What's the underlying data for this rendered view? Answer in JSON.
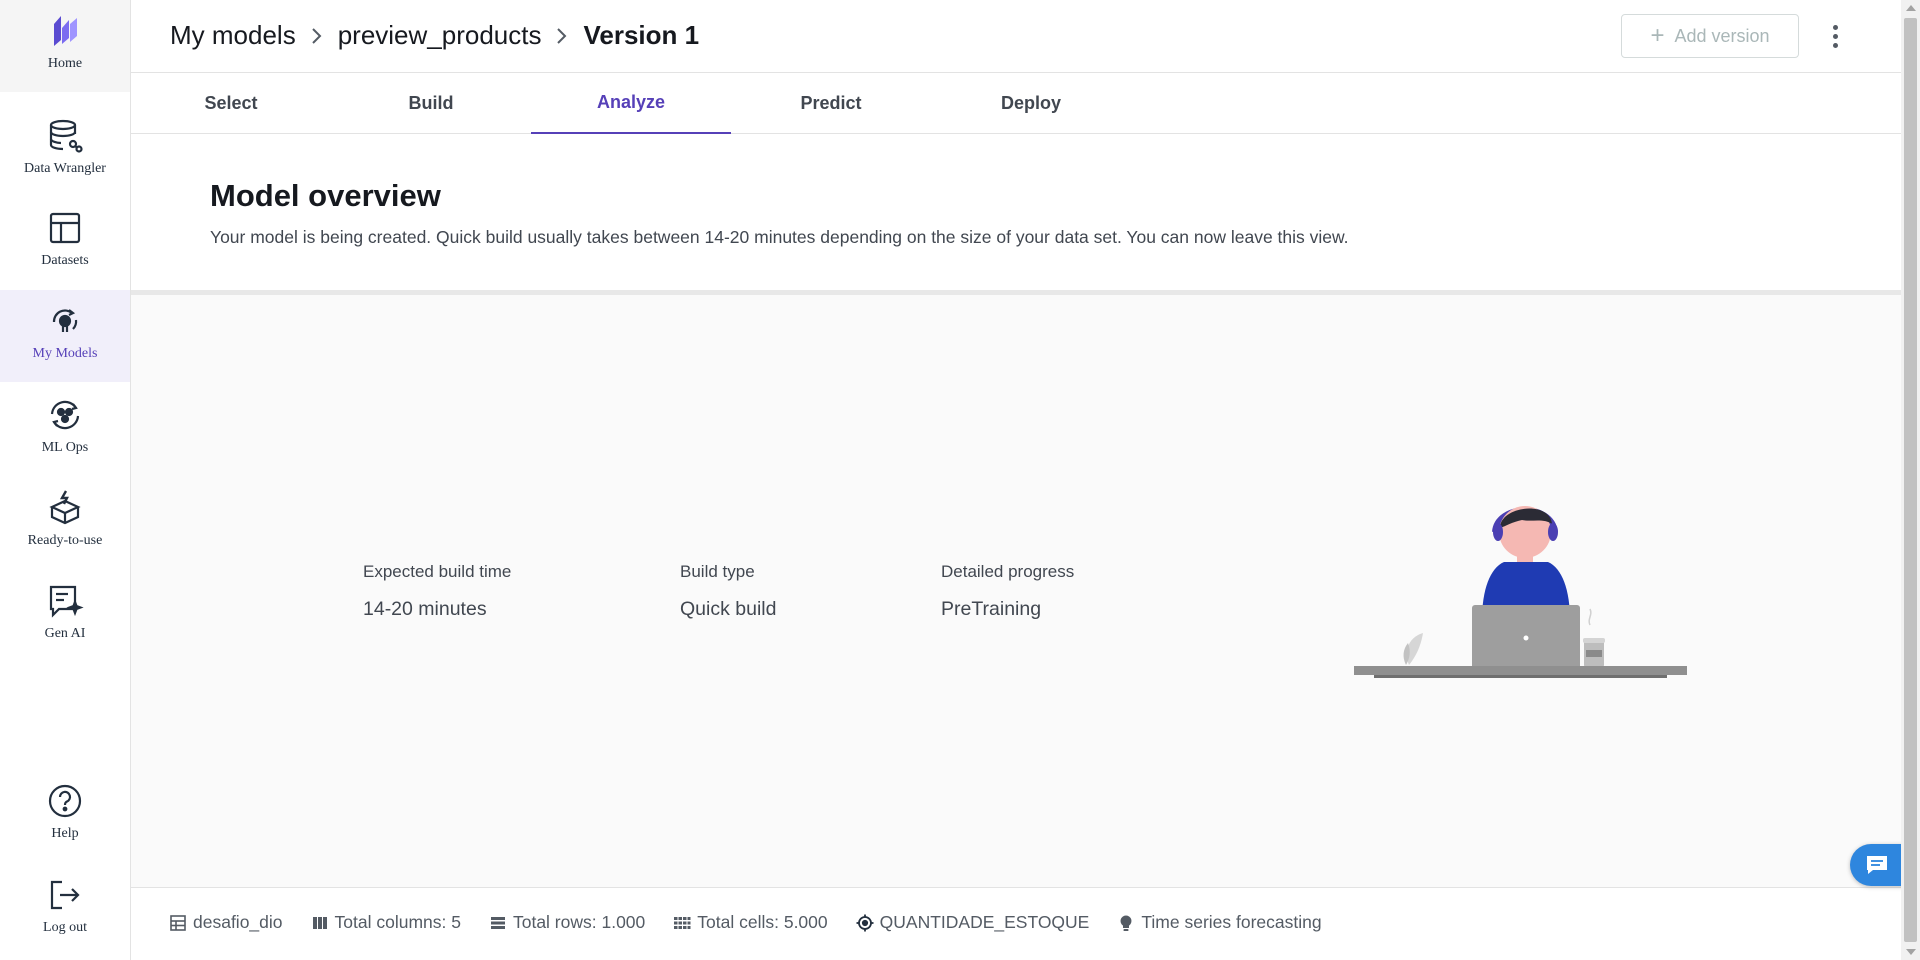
{
  "sidebar": {
    "items": [
      {
        "label": "Home",
        "icon": "canvas-logo-icon"
      },
      {
        "label": "Data Wrangler",
        "icon": "data-wrangler-icon"
      },
      {
        "label": "Datasets",
        "icon": "datasets-icon"
      },
      {
        "label": "My Models",
        "icon": "models-icon"
      },
      {
        "label": "ML Ops",
        "icon": "mlops-icon"
      },
      {
        "label": "Ready-to-use",
        "icon": "ready-to-use-icon"
      },
      {
        "label": "Gen AI",
        "icon": "gen-ai-icon"
      },
      {
        "label": "Help",
        "icon": "help-icon"
      },
      {
        "label": "Log out",
        "icon": "logout-icon"
      }
    ],
    "active": "My Models"
  },
  "header": {
    "breadcrumb": [
      "My models",
      "preview_products",
      "Version 1"
    ],
    "add_version_label": "Add version"
  },
  "tabs": [
    "Select",
    "Build",
    "Analyze",
    "Predict",
    "Deploy"
  ],
  "active_tab": "Analyze",
  "overview": {
    "title": "Model overview",
    "description": "Your model is being created. Quick build usually takes between 14-20 minutes depending on the size of your data set. You can now leave this view."
  },
  "stats": [
    {
      "label": "Expected build time",
      "value": "14-20 minutes"
    },
    {
      "label": "Build type",
      "value": "Quick build"
    },
    {
      "label": "Detailed progress",
      "value": "PreTraining"
    }
  ],
  "footer": {
    "dataset": "desafio_dio",
    "total_columns": "Total columns: 5",
    "total_rows": "Total rows: 1.000",
    "total_cells": "Total cells: 5.000",
    "target": "QUANTIDADE_ESTOQUE",
    "problem_type": "Time series forecasting"
  },
  "colors": {
    "accent": "#5640b8",
    "chat": "#2e86de"
  }
}
